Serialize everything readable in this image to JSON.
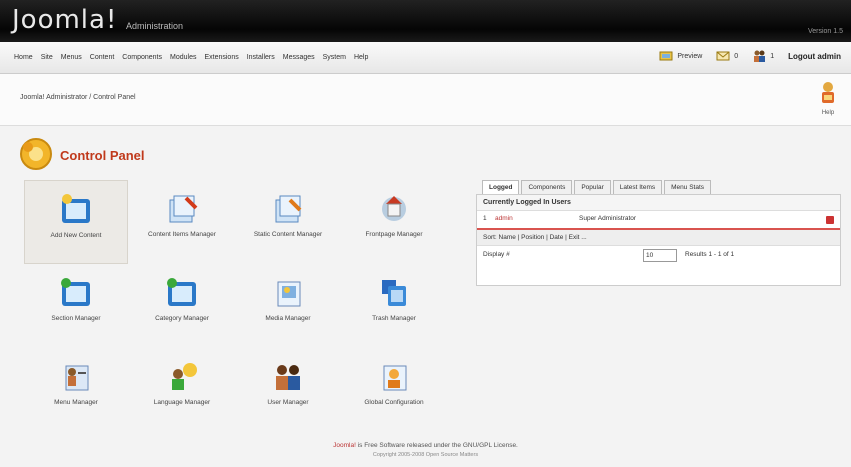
{
  "header": {
    "logo": "Joomla!",
    "subtitle": "Administration",
    "version": "Version 1.5"
  },
  "menubar": {
    "items": [
      "Home",
      "Site",
      "Menus",
      "Content",
      "Components",
      "Modules",
      "Extensions",
      "Installers",
      "Messages",
      "System",
      "Help"
    ],
    "preview_label": "Preview",
    "messages_count": "0",
    "users_count": "1",
    "logout_label": "Logout admin"
  },
  "toolbar": {
    "breadcrumb": "Joomla! Administrator / Control Panel",
    "help_label": "Help"
  },
  "page": {
    "title": "Control Panel"
  },
  "cpanel": {
    "tiles": [
      {
        "label": "Add New Content",
        "icon": "add-article-icon"
      },
      {
        "label": "Content Items Manager",
        "icon": "articles-manager-icon"
      },
      {
        "label": "Static Content Manager",
        "icon": "static-content-icon"
      },
      {
        "label": "Frontpage Manager",
        "icon": "frontpage-icon"
      },
      {
        "label": "Section Manager",
        "icon": "section-icon"
      },
      {
        "label": "Category Manager",
        "icon": "category-icon"
      },
      {
        "label": "Media Manager",
        "icon": "media-icon"
      },
      {
        "label": "Trash Manager",
        "icon": "trash-icon"
      },
      {
        "label": "Menu Manager",
        "icon": "menu-manager-icon"
      },
      {
        "label": "Language Manager",
        "icon": "language-icon"
      },
      {
        "label": "User Manager",
        "icon": "users-icon"
      },
      {
        "label": "Global Configuration",
        "icon": "config-icon"
      }
    ]
  },
  "panel": {
    "tabs": [
      "Logged",
      "Components",
      "Popular",
      "Latest Items",
      "Menu Stats"
    ],
    "heading": "Currently Logged In Users",
    "user": {
      "index": "1",
      "name": "admin",
      "group": "Super Administrator"
    },
    "filter_text": "Sort: Name | Position | Date | Exit ...",
    "display_label": "Display #",
    "display_value": "10",
    "results_text": "Results 1 - 1 of 1"
  },
  "footer": {
    "link": "Joomla!",
    "text": " is Free Software released under the GNU/GPL License.",
    "line2": "Copyright 2005-2008 Open Source Matters"
  }
}
